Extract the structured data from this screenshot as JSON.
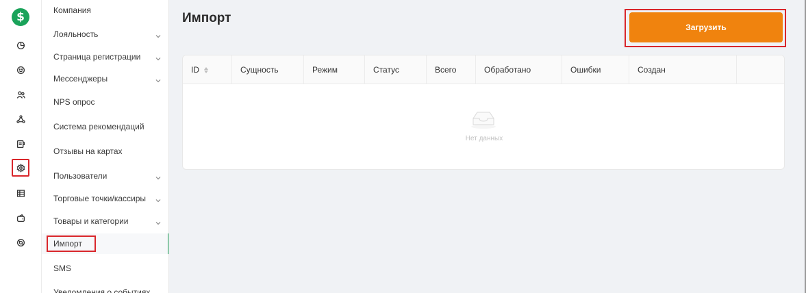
{
  "rail": {
    "logo_glyph": "$",
    "icons": [
      "analytics-icon",
      "loyalty-icon",
      "users-icon",
      "flows-icon",
      "orders-icon",
      "settings-icon",
      "table-icon",
      "wallet-icon",
      "support-icon"
    ],
    "active_icon": "settings-icon"
  },
  "menu": {
    "items": [
      {
        "label": "Компания",
        "has_chevron": false
      },
      {
        "label": "Лояльность",
        "has_chevron": true
      },
      {
        "label": "Страница регистрации",
        "has_chevron": true
      },
      {
        "label": "Мессенджеры",
        "has_chevron": true
      },
      {
        "label": "NPS опрос",
        "has_chevron": false
      },
      {
        "label": "Система рекомендаций",
        "has_chevron": false
      },
      {
        "label": "Отзывы на картах",
        "has_chevron": false
      },
      {
        "label": "Пользователи",
        "has_chevron": true
      },
      {
        "label": "Торговые точки/кассиры",
        "has_chevron": true
      },
      {
        "label": "Товары и категории",
        "has_chevron": true
      },
      {
        "label": "Импорт",
        "has_chevron": false,
        "selected": true
      },
      {
        "label": "SMS",
        "has_chevron": false
      },
      {
        "label": "Уведомления о событиях",
        "has_chevron": true
      }
    ]
  },
  "page": {
    "title": "Импорт",
    "upload_label": "Загрузить"
  },
  "table": {
    "columns": [
      "ID",
      "Сущность",
      "Режим",
      "Статус",
      "Всего",
      "Обработано",
      "Ошибки",
      "Создан",
      ""
    ],
    "empty_text": "Нет данных"
  },
  "colors": {
    "brand_green": "#1aa35a",
    "accent_orange": "#f0830e",
    "highlight_red": "#d9262b"
  }
}
